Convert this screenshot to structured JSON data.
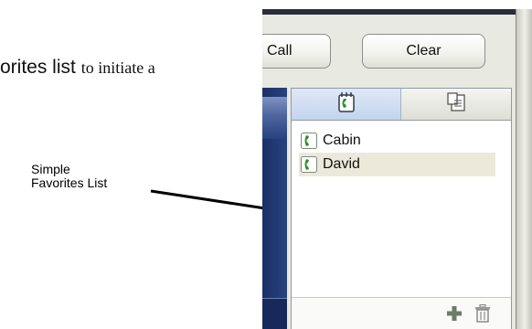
{
  "document": {
    "text_sans": "orites  list",
    "text_serif": "to initiate a",
    "callout_line1": "Simple",
    "callout_line2": "Favorites List"
  },
  "toolbar": {
    "call_label": "Call",
    "clear_label": "Clear"
  },
  "favorites": {
    "tabs": [
      {
        "icon": "phone-contact-icon",
        "active": true
      },
      {
        "icon": "contact-card-icon",
        "active": false
      }
    ],
    "items": [
      {
        "label": "Cabin",
        "icon": "phone-icon",
        "selected": false
      },
      {
        "label": "David",
        "icon": "phone-icon",
        "selected": true
      }
    ],
    "footer_icons": [
      "add-icon",
      "trash-icon"
    ]
  },
  "colors": {
    "phone_green": "#2f8f2a",
    "selection": "#ece9da",
    "active_tab": "#c3d4ee",
    "side_panel": "#27427f",
    "add_icon": "#6a7c6a"
  }
}
